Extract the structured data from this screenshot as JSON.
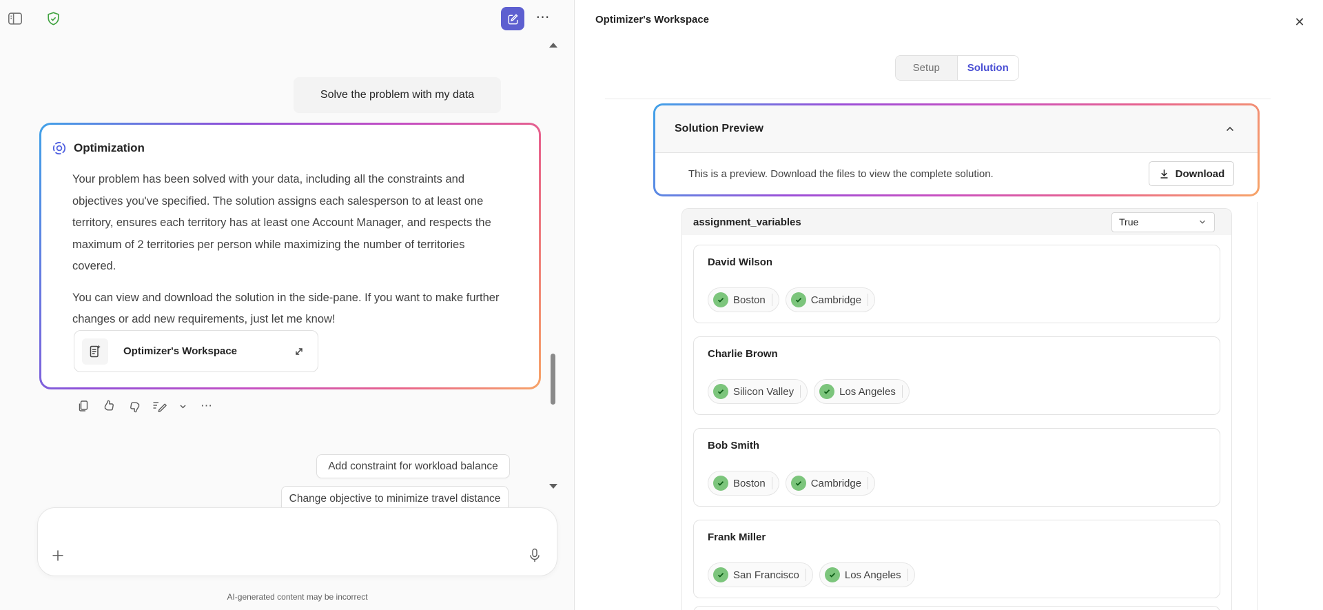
{
  "chat": {
    "header": {
      "more_glyph": "⋯"
    },
    "user_message": "Solve the problem with my data",
    "assistant": {
      "title": "Optimization",
      "paragraphs": [
        "Your problem has been solved with your data, including all the constraints and objectives you've specified. The solution assigns each salesperson to at least one territory, ensures each territory has at least one Account Manager, and respects the maximum of 2 territories per person while maximizing the number of territories covered.",
        "You can view and download the solution in the side-pane. If you want to make further changes or add new requirements, just let me know!"
      ],
      "attachment_label": "Optimizer's Workspace",
      "actions_more_glyph": "⋯"
    },
    "suggestions": [
      "Add constraint for workload balance",
      "Change objective to minimize travel distance"
    ],
    "disclaimer": "AI-generated content may be incorrect"
  },
  "panel": {
    "title": "Optimizer's Workspace",
    "close_glyph": "✕",
    "tabs": {
      "setup": "Setup",
      "solution": "Solution"
    },
    "preview": {
      "title": "Solution Preview",
      "note": "This is a preview. Download the files to view the complete solution.",
      "download_label": "Download"
    },
    "table": {
      "name": "assignment_variables",
      "filter_value": "True",
      "rows": [
        {
          "name": "David Wilson",
          "tags": [
            "Boston",
            "Cambridge"
          ]
        },
        {
          "name": "Charlie Brown",
          "tags": [
            "Silicon Valley",
            "Los Angeles"
          ]
        },
        {
          "name": "Bob Smith",
          "tags": [
            "Boston",
            "Cambridge"
          ]
        },
        {
          "name": "Frank Miller",
          "tags": [
            "San Francisco",
            "Los Angeles"
          ]
        }
      ]
    }
  },
  "colors": {
    "brand": "#5D5FD0",
    "active_tab_text": "#4A4FD4",
    "tag_green": "#7CC57C",
    "gradient_start": "#41A2E8",
    "gradient_mid": "#C94FC0",
    "gradient_end": "#F7A468"
  }
}
